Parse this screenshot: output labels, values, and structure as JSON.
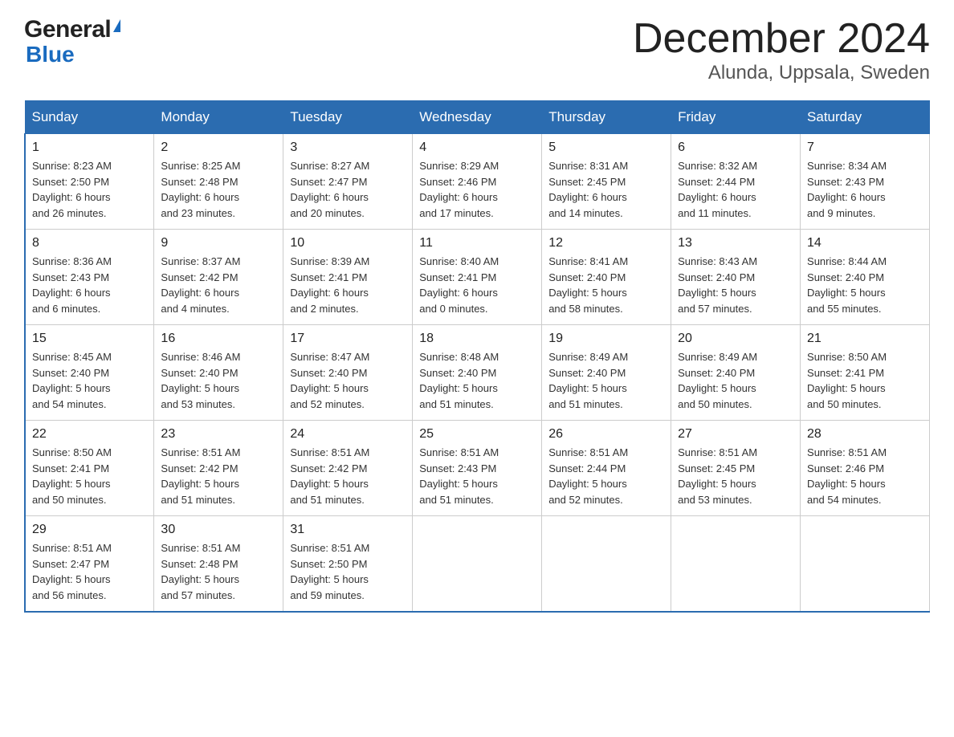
{
  "header": {
    "logo_general": "General",
    "logo_blue": "Blue",
    "month_title": "December 2024",
    "location": "Alunda, Uppsala, Sweden"
  },
  "weekdays": [
    "Sunday",
    "Monday",
    "Tuesday",
    "Wednesday",
    "Thursday",
    "Friday",
    "Saturday"
  ],
  "weeks": [
    [
      {
        "day": "1",
        "sunrise": "8:23 AM",
        "sunset": "2:50 PM",
        "daylight": "6 hours and 26 minutes."
      },
      {
        "day": "2",
        "sunrise": "8:25 AM",
        "sunset": "2:48 PM",
        "daylight": "6 hours and 23 minutes."
      },
      {
        "day": "3",
        "sunrise": "8:27 AM",
        "sunset": "2:47 PM",
        "daylight": "6 hours and 20 minutes."
      },
      {
        "day": "4",
        "sunrise": "8:29 AM",
        "sunset": "2:46 PM",
        "daylight": "6 hours and 17 minutes."
      },
      {
        "day": "5",
        "sunrise": "8:31 AM",
        "sunset": "2:45 PM",
        "daylight": "6 hours and 14 minutes."
      },
      {
        "day": "6",
        "sunrise": "8:32 AM",
        "sunset": "2:44 PM",
        "daylight": "6 hours and 11 minutes."
      },
      {
        "day": "7",
        "sunrise": "8:34 AM",
        "sunset": "2:43 PM",
        "daylight": "6 hours and 9 minutes."
      }
    ],
    [
      {
        "day": "8",
        "sunrise": "8:36 AM",
        "sunset": "2:43 PM",
        "daylight": "6 hours and 6 minutes."
      },
      {
        "day": "9",
        "sunrise": "8:37 AM",
        "sunset": "2:42 PM",
        "daylight": "6 hours and 4 minutes."
      },
      {
        "day": "10",
        "sunrise": "8:39 AM",
        "sunset": "2:41 PM",
        "daylight": "6 hours and 2 minutes."
      },
      {
        "day": "11",
        "sunrise": "8:40 AM",
        "sunset": "2:41 PM",
        "daylight": "6 hours and 0 minutes."
      },
      {
        "day": "12",
        "sunrise": "8:41 AM",
        "sunset": "2:40 PM",
        "daylight": "5 hours and 58 minutes."
      },
      {
        "day": "13",
        "sunrise": "8:43 AM",
        "sunset": "2:40 PM",
        "daylight": "5 hours and 57 minutes."
      },
      {
        "day": "14",
        "sunrise": "8:44 AM",
        "sunset": "2:40 PM",
        "daylight": "5 hours and 55 minutes."
      }
    ],
    [
      {
        "day": "15",
        "sunrise": "8:45 AM",
        "sunset": "2:40 PM",
        "daylight": "5 hours and 54 minutes."
      },
      {
        "day": "16",
        "sunrise": "8:46 AM",
        "sunset": "2:40 PM",
        "daylight": "5 hours and 53 minutes."
      },
      {
        "day": "17",
        "sunrise": "8:47 AM",
        "sunset": "2:40 PM",
        "daylight": "5 hours and 52 minutes."
      },
      {
        "day": "18",
        "sunrise": "8:48 AM",
        "sunset": "2:40 PM",
        "daylight": "5 hours and 51 minutes."
      },
      {
        "day": "19",
        "sunrise": "8:49 AM",
        "sunset": "2:40 PM",
        "daylight": "5 hours and 51 minutes."
      },
      {
        "day": "20",
        "sunrise": "8:49 AM",
        "sunset": "2:40 PM",
        "daylight": "5 hours and 50 minutes."
      },
      {
        "day": "21",
        "sunrise": "8:50 AM",
        "sunset": "2:41 PM",
        "daylight": "5 hours and 50 minutes."
      }
    ],
    [
      {
        "day": "22",
        "sunrise": "8:50 AM",
        "sunset": "2:41 PM",
        "daylight": "5 hours and 50 minutes."
      },
      {
        "day": "23",
        "sunrise": "8:51 AM",
        "sunset": "2:42 PM",
        "daylight": "5 hours and 51 minutes."
      },
      {
        "day": "24",
        "sunrise": "8:51 AM",
        "sunset": "2:42 PM",
        "daylight": "5 hours and 51 minutes."
      },
      {
        "day": "25",
        "sunrise": "8:51 AM",
        "sunset": "2:43 PM",
        "daylight": "5 hours and 51 minutes."
      },
      {
        "day": "26",
        "sunrise": "8:51 AM",
        "sunset": "2:44 PM",
        "daylight": "5 hours and 52 minutes."
      },
      {
        "day": "27",
        "sunrise": "8:51 AM",
        "sunset": "2:45 PM",
        "daylight": "5 hours and 53 minutes."
      },
      {
        "day": "28",
        "sunrise": "8:51 AM",
        "sunset": "2:46 PM",
        "daylight": "5 hours and 54 minutes."
      }
    ],
    [
      {
        "day": "29",
        "sunrise": "8:51 AM",
        "sunset": "2:47 PM",
        "daylight": "5 hours and 56 minutes."
      },
      {
        "day": "30",
        "sunrise": "8:51 AM",
        "sunset": "2:48 PM",
        "daylight": "5 hours and 57 minutes."
      },
      {
        "day": "31",
        "sunrise": "8:51 AM",
        "sunset": "2:50 PM",
        "daylight": "5 hours and 59 minutes."
      },
      null,
      null,
      null,
      null
    ]
  ],
  "labels": {
    "sunrise": "Sunrise:",
    "sunset": "Sunset:",
    "daylight": "Daylight:"
  }
}
